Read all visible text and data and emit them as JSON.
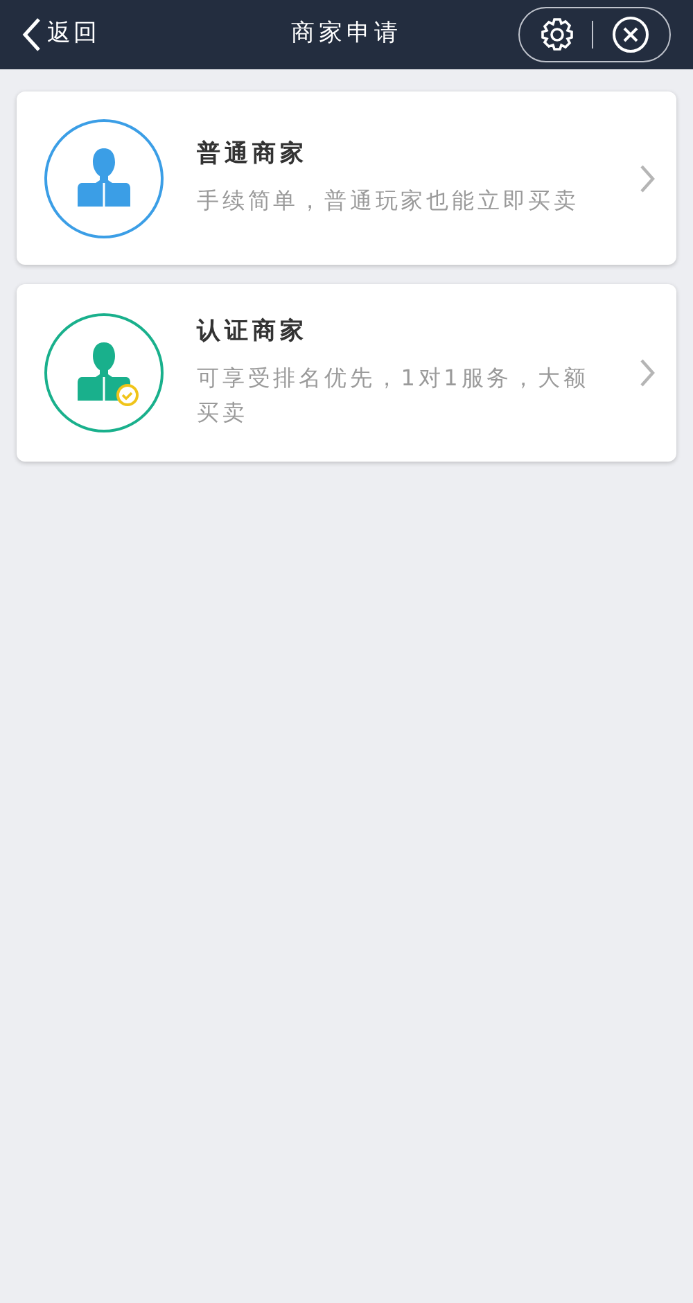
{
  "header": {
    "back": "返回",
    "title": "商家申请"
  },
  "options": [
    {
      "kind": "basic",
      "color": "#3b9ee6",
      "title": "普通商家",
      "description": "手续简单，普通玩家也能立即买卖"
    },
    {
      "kind": "verified",
      "color": "#19b08c",
      "title": "认证商家",
      "description": "可享受排名优先，1对1服务，大额买卖"
    }
  ]
}
